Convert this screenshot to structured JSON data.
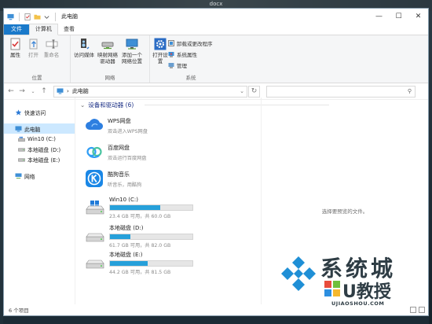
{
  "desktop": {
    "title": "docx"
  },
  "window": {
    "title": "此电脑",
    "controls": {
      "minimize": "—",
      "maximize": "☐",
      "close": "✕"
    }
  },
  "tabs": [
    {
      "label": "文件"
    },
    {
      "label": "计算机"
    },
    {
      "label": "查看"
    }
  ],
  "ribbon": {
    "location_group": {
      "label": "位置",
      "buttons": [
        {
          "label": "属性",
          "icon": "checklist-icon"
        },
        {
          "label": "打开",
          "icon": "open-icon"
        },
        {
          "label": "重命名",
          "icon": "rename-icon"
        }
      ]
    },
    "network_group": {
      "label": "网络",
      "buttons": [
        {
          "label": "访问媒体",
          "icon": "media-icon"
        },
        {
          "label": "映射网络驱动器",
          "icon": "map-drive-icon"
        },
        {
          "label": "添加一个网络位置",
          "icon": "network-location-icon"
        }
      ]
    },
    "system_group": {
      "label": "系统",
      "open_settings": "打开设置",
      "small_items": [
        {
          "label": "卸载或更改程序",
          "icon": "uninstall-icon"
        },
        {
          "label": "系统属性",
          "icon": "system-properties-icon"
        },
        {
          "label": "管理",
          "icon": "manage-icon"
        }
      ]
    }
  },
  "address": {
    "path": "此电脑",
    "separator": "›",
    "search_placeholder": ""
  },
  "nav": {
    "quick_access": "快速访问",
    "this_pc": "此电脑",
    "drives": [
      "Win10 (C:)",
      "本地磁盘 (D:)",
      "本地磁盘 (E:)"
    ],
    "network": "网络"
  },
  "section": {
    "title": "设备和驱动器 (6)"
  },
  "apps": [
    {
      "name": "WPS网盘",
      "desc": "双击进入WPS网盘",
      "icon": "wps-cloud-icon",
      "color": "#2e7fe0"
    },
    {
      "name": "百度网盘",
      "desc": "双击运行百度网盘",
      "icon": "baidu-netdisk-icon",
      "color": "#2f9df5"
    },
    {
      "name": "酷狗音乐",
      "desc": "听音乐，用酷狗",
      "icon": "kugou-icon",
      "color": "#1a87e6"
    }
  ],
  "drives": [
    {
      "name": "Win10 (C:)",
      "space": "23.4 GB 可用，共 60.0 GB",
      "used_fraction": 0.61,
      "icon": "windows-drive-icon"
    },
    {
      "name": "本地磁盘 (D:)",
      "space": "61.7 GB 可用，共 82.0 GB",
      "used_fraction": 0.25,
      "icon": "hard-drive-icon"
    },
    {
      "name": "本地磁盘 (E:)",
      "space": "44.2 GB 可用，共 81.5 GB",
      "used_fraction": 0.46,
      "icon": "hard-drive-icon"
    }
  ],
  "preview": {
    "message": "选择要预览的文件。"
  },
  "status": {
    "count": "6 个项目"
  },
  "watermark": {
    "line1": "系统城",
    "line2": "U教授",
    "url": "UJIAOSHOU.COM"
  }
}
